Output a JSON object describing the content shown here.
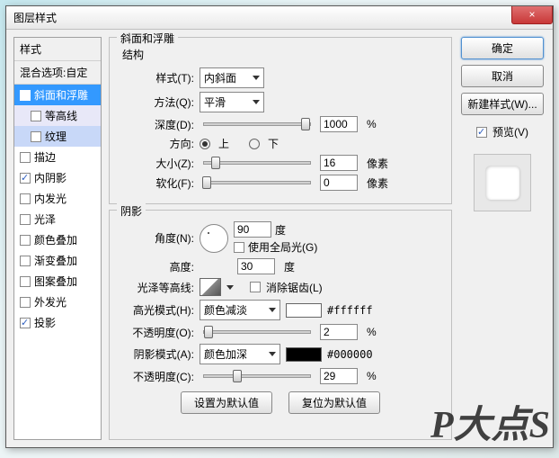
{
  "window_title": "图层样式",
  "close_x": "×",
  "sidebar": {
    "header": "样式",
    "blend": "混合选项:自定",
    "items": [
      {
        "label": "斜面和浮雕",
        "checked": true,
        "selected": true
      },
      {
        "label": "等高线",
        "checked": false,
        "sub": true
      },
      {
        "label": "纹理",
        "checked": false,
        "sub": true,
        "hl": true
      },
      {
        "label": "描边",
        "checked": false
      },
      {
        "label": "内阴影",
        "checked": true
      },
      {
        "label": "内发光",
        "checked": false
      },
      {
        "label": "光泽",
        "checked": false
      },
      {
        "label": "颜色叠加",
        "checked": false
      },
      {
        "label": "渐变叠加",
        "checked": false
      },
      {
        "label": "图案叠加",
        "checked": false
      },
      {
        "label": "外发光",
        "checked": false
      },
      {
        "label": "投影",
        "checked": true
      }
    ]
  },
  "main": {
    "title": "斜面和浮雕",
    "struct": "结构",
    "style_lbl": "样式(T):",
    "style_val": "内斜面",
    "method_lbl": "方法(Q):",
    "method_val": "平滑",
    "depth_lbl": "深度(D):",
    "depth_val": "1000",
    "depth_unit": "%",
    "dir_lbl": "方向:",
    "dir_up": "上",
    "dir_down": "下",
    "size_lbl": "大小(Z):",
    "size_val": "16",
    "px": "像素",
    "soften_lbl": "软化(F):",
    "soften_val": "0",
    "shadow": "阴影",
    "angle_lbl": "角度(N):",
    "angle_val": "90",
    "deg": "度",
    "global": "使用全局光(G)",
    "alt_lbl": "高度:",
    "alt_val": "30",
    "gloss_lbl": "光泽等高线:",
    "antialias": "消除锯齿(L)",
    "hi_mode_lbl": "高光模式(H):",
    "hi_mode_val": "颜色减淡",
    "hi_color": "#ffffff",
    "hi_hex": "#ffffff",
    "hi_op_lbl": "不透明度(O):",
    "hi_op_val": "2",
    "pct": "%",
    "sh_mode_lbl": "阴影模式(A):",
    "sh_mode_val": "颜色加深",
    "sh_color": "#000000",
    "sh_hex": "#000000",
    "sh_op_lbl": "不透明度(C):",
    "sh_op_val": "29",
    "make_default": "设置为默认值",
    "reset_default": "复位为默认值"
  },
  "right": {
    "ok": "确定",
    "cancel": "取消",
    "new_style": "新建样式(W)...",
    "preview": "预览(V)"
  },
  "watermark": "P大点S"
}
